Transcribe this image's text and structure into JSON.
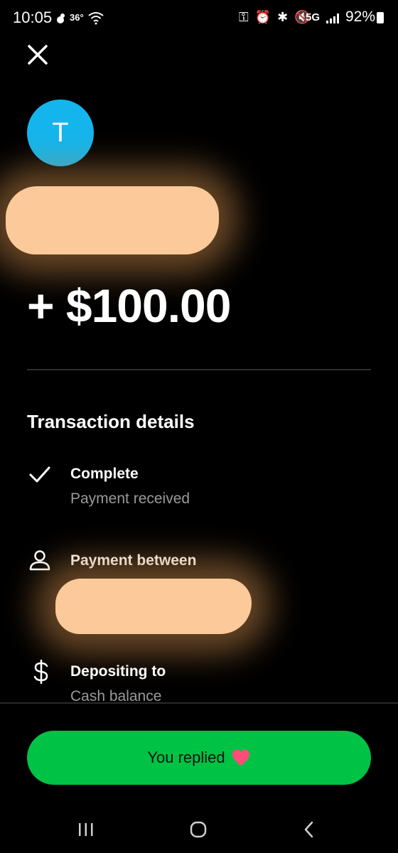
{
  "status_bar": {
    "time": "10:05",
    "temp": "36°",
    "icons_text": "⚿ ⏰ ✱ 🔇",
    "network": "5G",
    "battery": "92%"
  },
  "avatar": {
    "initial": "T",
    "color": "#14b5ec"
  },
  "amount": "+ $100.00",
  "details": {
    "title": "Transaction details",
    "status_title": "Complete",
    "status_sub": "Payment received",
    "between_title": "Payment between",
    "deposit_title": "Depositing to",
    "deposit_sub": "Cash balance"
  },
  "cta": {
    "label": "You replied",
    "color": "#00c244",
    "icon": "heart-icon"
  },
  "colors": {
    "redaction": "#fcc99a",
    "accent": "#00c244"
  }
}
